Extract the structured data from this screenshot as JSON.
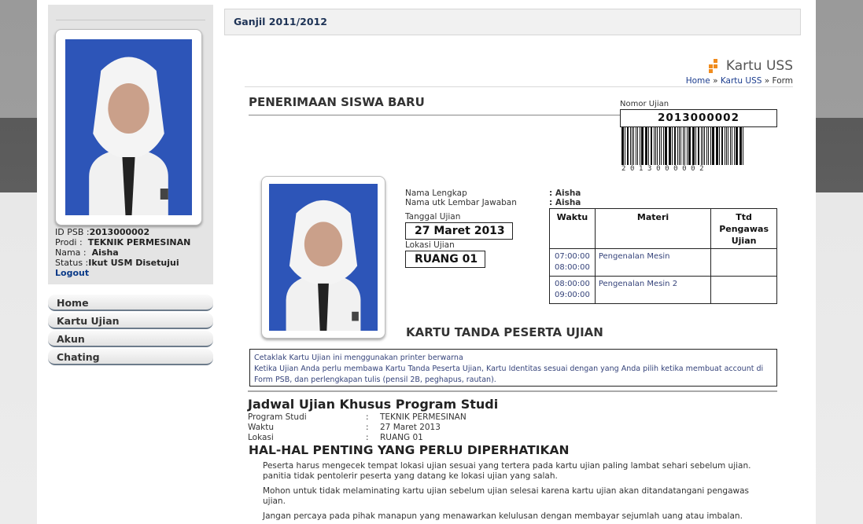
{
  "header": {
    "period": "Ganjil 2011/2012"
  },
  "page_heading": {
    "title": "Kartu USS",
    "breadcrumb": {
      "home": "Home",
      "sep1": "»",
      "parent": "Kartu USS",
      "sep2": "»",
      "current": "Form"
    }
  },
  "profile": {
    "id_label": "ID PSB :",
    "id_value": "2013000002",
    "prodi_label": "Prodi :",
    "prodi_value": "TEKNIK PERMESINAN",
    "nama_label": "Nama :",
    "nama_value": "Aisha",
    "status_label": "Status :",
    "status_value": "Ikut USM Disetujui",
    "logout": "Logout"
  },
  "sidebar": {
    "items": [
      {
        "label": "Home"
      },
      {
        "label": "Kartu Ujian"
      },
      {
        "label": "Akun"
      },
      {
        "label": "Chating"
      }
    ]
  },
  "card": {
    "section_title": "PENERIMAAN SISWA BARU",
    "exam_number_label": "Nomor Ujian",
    "exam_number": "2013000002",
    "barcode_digits": "2013000002",
    "fields": {
      "nama_lengkap_label": "Nama Lengkap",
      "nama_lengkap_value": ": Aisha",
      "nama_ljk_label": "Nama utk Lembar Jawaban",
      "nama_ljk_value": ": Aisha",
      "tanggal_label": "Tanggal Ujian",
      "tanggal_value": "27 Maret 2013",
      "lokasi_label": "Lokasi Ujian",
      "lokasi_value": "RUANG 01"
    },
    "schedule": {
      "headers": {
        "waktu": "Waktu",
        "materi": "Materi",
        "ttd": "Ttd Pengawas Ujian"
      },
      "rows": [
        {
          "start": "07:00:00",
          "end": "08:00:00",
          "materi": "Pengenalan Mesin",
          "ttd": ""
        },
        {
          "start": "08:00:00",
          "end": "09:00:00",
          "materi": "Pengenalan Mesin 2",
          "ttd": ""
        }
      ]
    },
    "ktpu_title": "KARTU TANDA PESERTA UJIAN",
    "notice_line1": "Cetaklak Kartu Ujian ini menggunakan printer berwarna",
    "notice_line2": "Ketika Ujian Anda perlu membawa Kartu Tanda Peserta Ujian, Kartu Identitas sesuai dengan yang Anda pilih ketika membuat account di Form PSB, dan perlengkapan tulis (pensil 2B, peghapus, rautan)."
  },
  "jadwal": {
    "title": "Jadwal Ujian Khusus Program Studi",
    "rows": [
      {
        "label": "Program Studi",
        "colon": ":",
        "value": "TEKNIK PERMESINAN"
      },
      {
        "label": "Waktu",
        "colon": ":",
        "value": "27 Maret 2013"
      },
      {
        "label": "Lokasi",
        "colon": ":",
        "value": "RUANG 01"
      }
    ]
  },
  "penting": {
    "title": "HAL-HAL PENTING YANG PERLU DIPERHATIKAN",
    "items": [
      "Peserta harus mengecek tempat lokasi ujian sesuai yang tertera pada kartu ujian paling lambat sehari sebelum ujian. panitia tidak pentolerir peserta yang datang ke lokasi ujian yang salah.",
      "Mohon untuk tidak melaminating kartu ujian sebelum ujian selesai karena kartu ujian akan ditandatangani pengawas ujian.",
      "Jangan percaya pada pihak manapun yang menawarkan kelulusan dengan membayar sejumlah uang atau imbalan."
    ]
  },
  "colors": {
    "accent_orange": "#f08c1e",
    "link_blue": "#1c3d8e",
    "photo_bg": "#2d55b8"
  },
  "icons": {
    "heading_icon": "orange-squares-icon",
    "photo": "student-photo"
  }
}
